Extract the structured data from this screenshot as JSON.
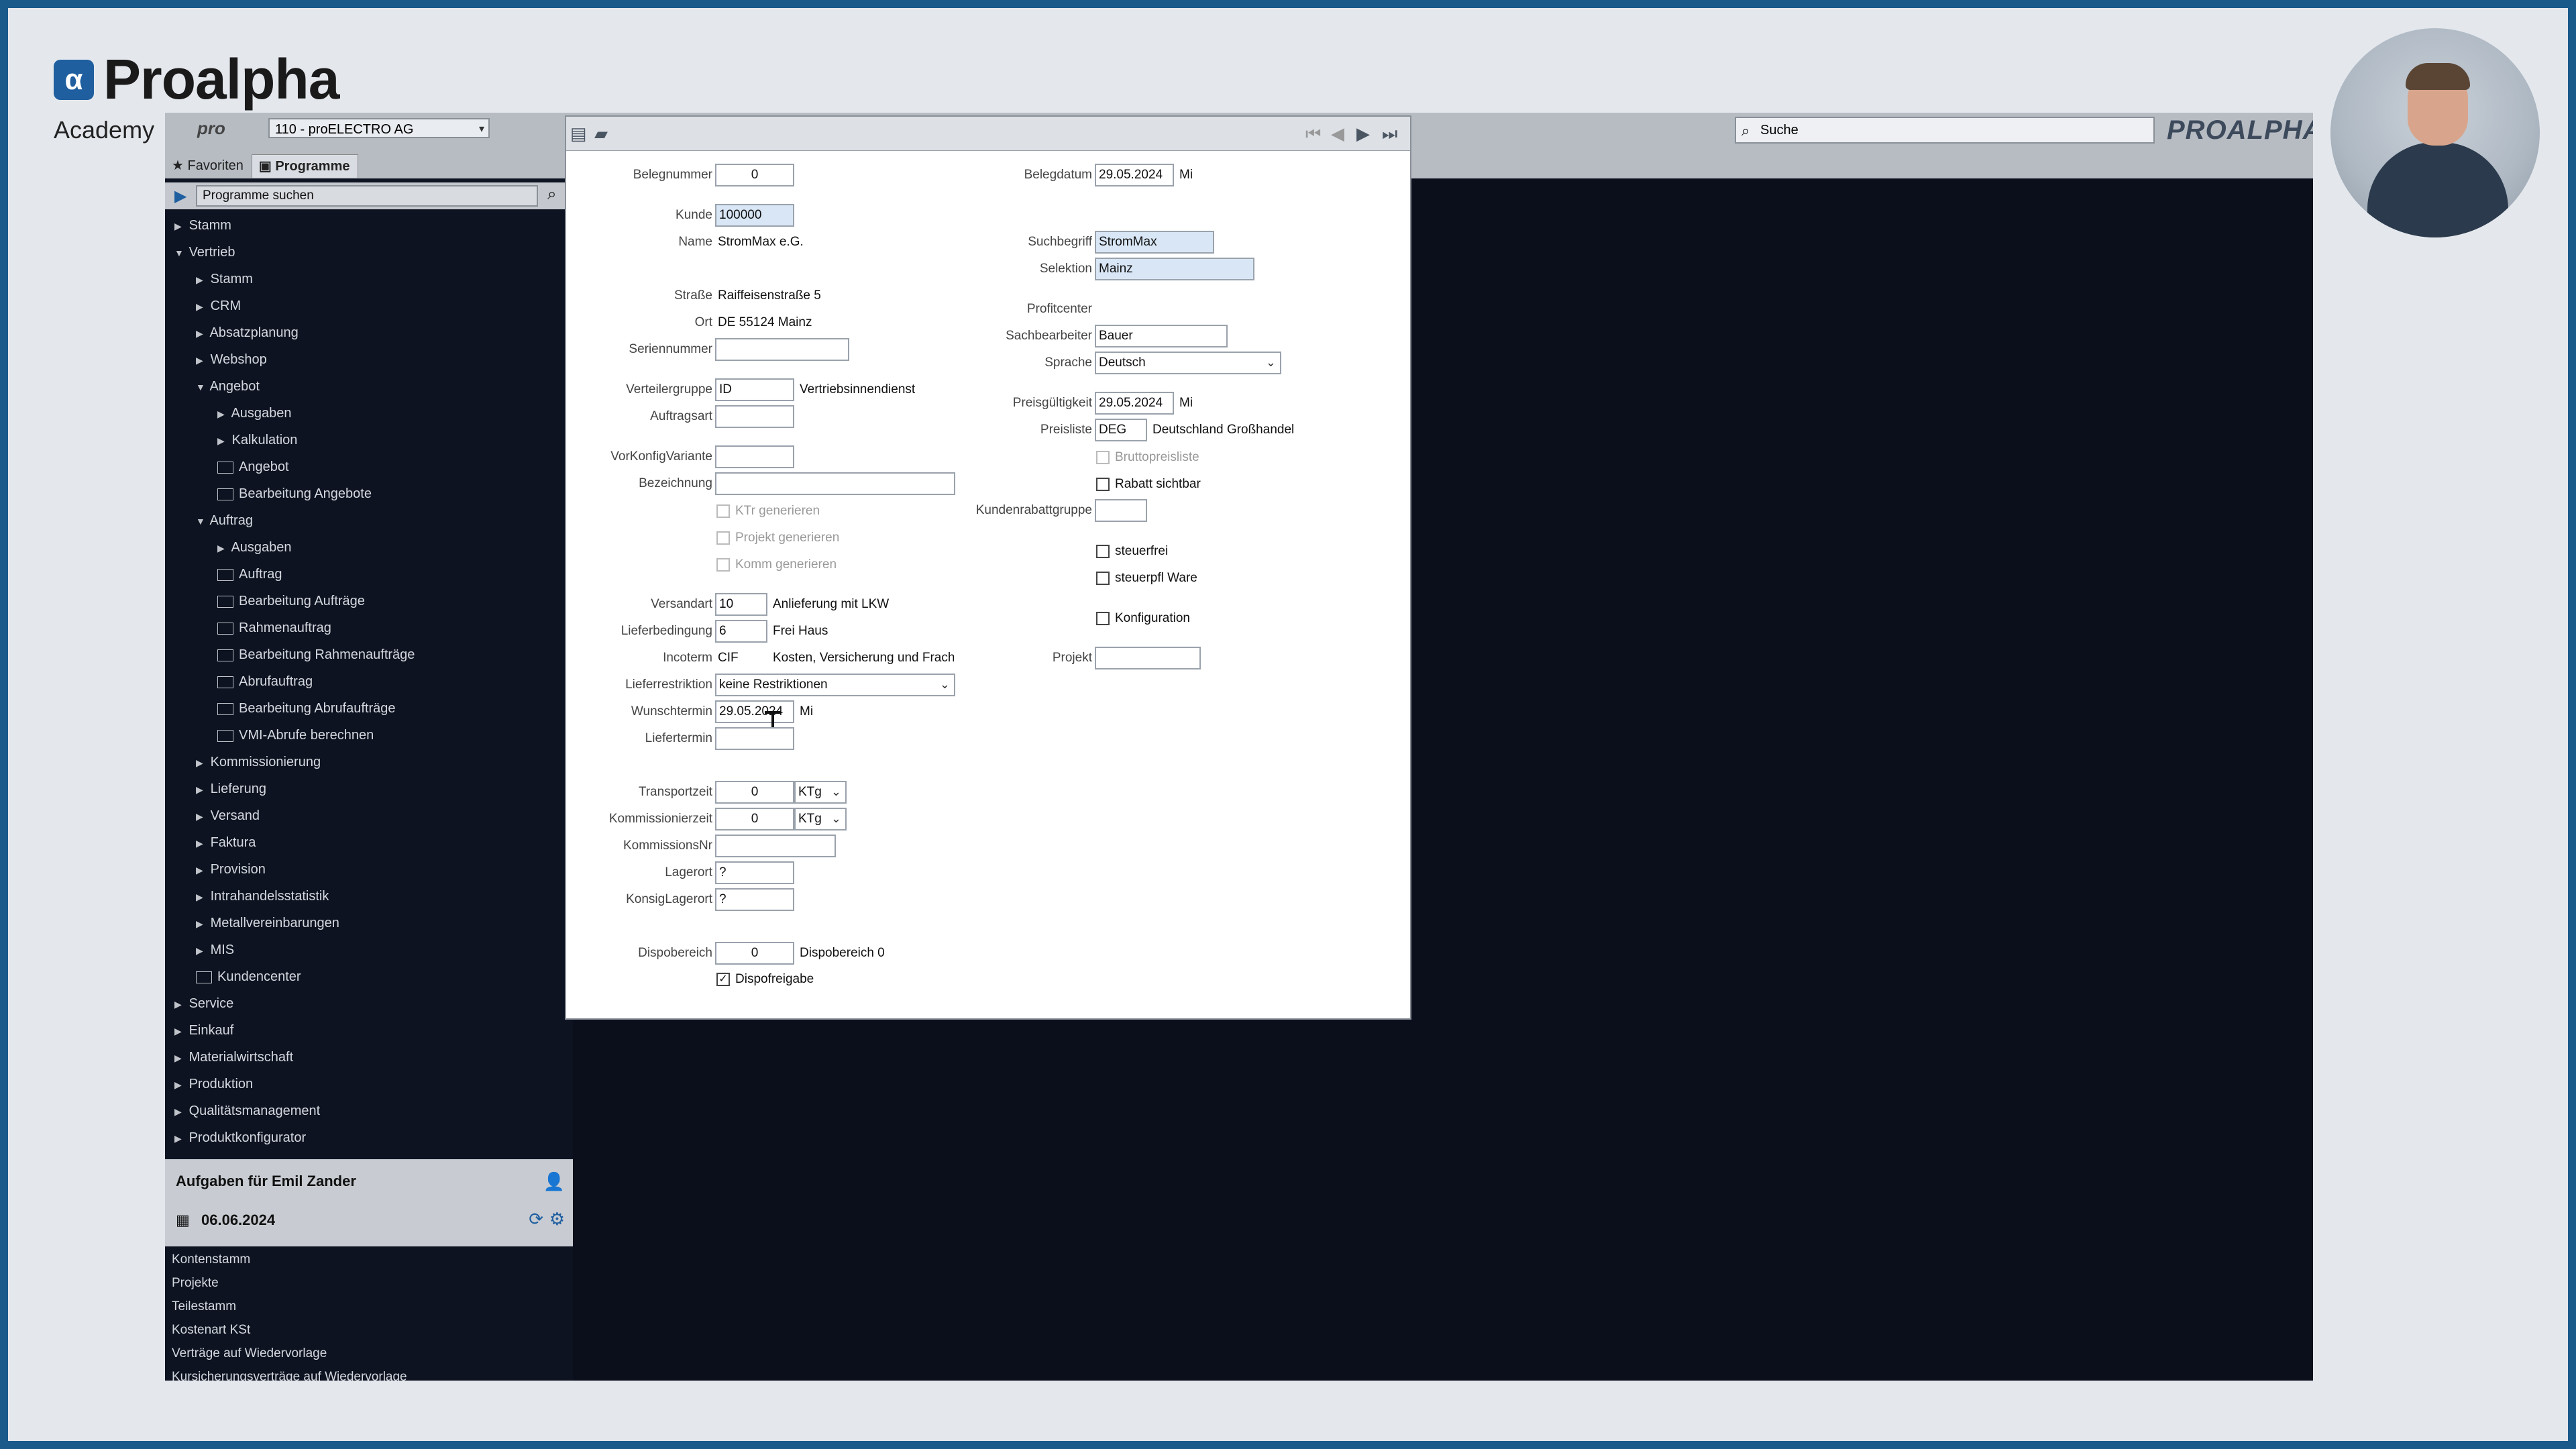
{
  "brand": {
    "name": "Proalpha",
    "sub": "Academy",
    "mark": "α"
  },
  "topbar": {
    "pro_label": "pro",
    "company": "110 - proELECTRO AG",
    "tab_favorites": "Favoriten",
    "tab_programs": "Programme",
    "search_placeholder": "Suche",
    "logo_text": "PROALPHA"
  },
  "sidebar": {
    "program_search": "Programme suchen",
    "tree": [
      {
        "label": "Stamm",
        "level": 0,
        "exp": "closed",
        "icon": false
      },
      {
        "label": "Vertrieb",
        "level": 0,
        "exp": "open",
        "icon": false
      },
      {
        "label": "Stamm",
        "level": 1,
        "exp": "closed",
        "icon": false
      },
      {
        "label": "CRM",
        "level": 1,
        "exp": "closed",
        "icon": false
      },
      {
        "label": "Absatzplanung",
        "level": 1,
        "exp": "closed",
        "icon": false
      },
      {
        "label": "Webshop",
        "level": 1,
        "exp": "closed",
        "icon": false
      },
      {
        "label": "Angebot",
        "level": 1,
        "exp": "open",
        "icon": false
      },
      {
        "label": "Ausgaben",
        "level": 2,
        "exp": "closed",
        "icon": false
      },
      {
        "label": "Kalkulation",
        "level": 2,
        "exp": "closed",
        "icon": false
      },
      {
        "label": "Angebot",
        "level": 2,
        "exp": "",
        "icon": true
      },
      {
        "label": "Bearbeitung Angebote",
        "level": 2,
        "exp": "",
        "icon": true
      },
      {
        "label": "Auftrag",
        "level": 1,
        "exp": "open",
        "icon": false
      },
      {
        "label": "Ausgaben",
        "level": 2,
        "exp": "closed",
        "icon": false
      },
      {
        "label": "Auftrag",
        "level": 2,
        "exp": "",
        "icon": true
      },
      {
        "label": "Bearbeitung Aufträge",
        "level": 2,
        "exp": "",
        "icon": true
      },
      {
        "label": "Rahmenauftrag",
        "level": 2,
        "exp": "",
        "icon": true
      },
      {
        "label": "Bearbeitung Rahmenaufträge",
        "level": 2,
        "exp": "",
        "icon": true
      },
      {
        "label": "Abrufauftrag",
        "level": 2,
        "exp": "",
        "icon": true
      },
      {
        "label": "Bearbeitung Abrufaufträge",
        "level": 2,
        "exp": "",
        "icon": true
      },
      {
        "label": "VMI-Abrufe berechnen",
        "level": 2,
        "exp": "",
        "icon": true
      },
      {
        "label": "Kommissionierung",
        "level": 1,
        "exp": "closed",
        "icon": false
      },
      {
        "label": "Lieferung",
        "level": 1,
        "exp": "closed",
        "icon": false
      },
      {
        "label": "Versand",
        "level": 1,
        "exp": "closed",
        "icon": false
      },
      {
        "label": "Faktura",
        "level": 1,
        "exp": "closed",
        "icon": false
      },
      {
        "label": "Provision",
        "level": 1,
        "exp": "closed",
        "icon": false
      },
      {
        "label": "Intrahandelsstatistik",
        "level": 1,
        "exp": "closed",
        "icon": false
      },
      {
        "label": "Metallvereinbarungen",
        "level": 1,
        "exp": "closed",
        "icon": false
      },
      {
        "label": "MIS",
        "level": 1,
        "exp": "closed",
        "icon": false
      },
      {
        "label": "Kundencenter",
        "level": 1,
        "exp": "",
        "icon": true
      },
      {
        "label": "Service",
        "level": 0,
        "exp": "closed",
        "icon": false
      },
      {
        "label": "Einkauf",
        "level": 0,
        "exp": "closed",
        "icon": false
      },
      {
        "label": "Materialwirtschaft",
        "level": 0,
        "exp": "closed",
        "icon": false
      },
      {
        "label": "Produktion",
        "level": 0,
        "exp": "closed",
        "icon": false
      },
      {
        "label": "Qualitätsmanagement",
        "level": 0,
        "exp": "closed",
        "icon": false
      },
      {
        "label": "Produktkonfigurator",
        "level": 0,
        "exp": "closed",
        "icon": false
      }
    ],
    "tasks_title": "Aufgaben für Emil Zander",
    "tasks_date": "06.06.2024",
    "tasks": [
      "Kontenstamm",
      "Projekte",
      "Teilestamm",
      "Kostenart KSt",
      "Verträge auf Wiedervorlage",
      "Kursicherungsverträge auf Wiedervorlage"
    ]
  },
  "form": {
    "belegnummer_label": "Belegnummer",
    "belegnummer": "0",
    "kunde_label": "Kunde",
    "kunde": "100000",
    "name_label": "Name",
    "name": "StromMax e.G.",
    "strasse_label": "Straße",
    "strasse": "Raiffeisenstraße 5",
    "ort_label": "Ort",
    "ort": "DE 55124 Mainz",
    "seriennummer_label": "Seriennummer",
    "seriennummer": "",
    "verteilergruppe_label": "Verteilergruppe",
    "verteilergruppe": "ID",
    "verteilergruppe_text": "Vertriebsinnendienst",
    "auftragsart_label": "Auftragsart",
    "auftragsart": "",
    "vorkonfig_label": "VorKonfigVariante",
    "vorkonfig": "",
    "bezeichnung_label": "Bezeichnung",
    "bezeichnung": "",
    "ktr_label": "KTr generieren",
    "projekt_gen_label": "Projekt generieren",
    "komm_label": "Komm generieren",
    "versandart_label": "Versandart",
    "versandart": "10",
    "versandart_text": "Anlieferung mit LKW",
    "lieferbedingung_label": "Lieferbedingung",
    "lieferbedingung": "6",
    "lieferbedingung_text": "Frei Haus",
    "incoterm_label": "Incoterm",
    "incoterm": "CIF",
    "incoterm_text": "Kosten, Versicherung und Fracht",
    "lieferrestriktion_label": "Lieferrestriktion",
    "lieferrestriktion": "keine Restriktionen",
    "wunschtermin_label": "Wunschtermin",
    "wunschtermin": "29.05.2024",
    "wunschtermin_day": "Mi",
    "liefertermin_label": "Liefertermin",
    "liefertermin": "",
    "transportzeit_label": "Transportzeit",
    "transportzeit": "0",
    "transportzeit_unit": "KTg",
    "kommzeit_label": "Kommissionierzeit",
    "kommzeit": "0",
    "kommzeit_unit": "KTg",
    "kommnr_label": "KommissionsNr",
    "kommnr": "",
    "lagerort_label": "Lagerort",
    "lagerort": "?",
    "konsig_label": "KonsigLagerort",
    "konsig": "?",
    "dispobereich_label": "Dispobereich",
    "dispobereich": "0",
    "dispobereich_text": "Dispobereich 0",
    "dispofreigabe_label": "Dispofreigabe",
    "belegdatum_label": "Belegdatum",
    "belegdatum": "29.05.2024",
    "belegdatum_day": "Mi",
    "suchbegriff_label": "Suchbegriff",
    "suchbegriff": "StromMax",
    "selektion_label": "Selektion",
    "selektion": "Mainz",
    "profitcenter_label": "Profitcenter",
    "sachbearbeiter_label": "Sachbearbeiter",
    "sachbearbeiter": "Bauer",
    "sprache_label": "Sprache",
    "sprache": "Deutsch",
    "preisgueltigkeit_label": "Preisgültigkeit",
    "preisgueltigkeit": "29.05.2024",
    "preisgueltigkeit_day": "Mi",
    "preisliste_label": "Preisliste",
    "preisliste": "DEG",
    "preisliste_text": "Deutschland Großhandel",
    "bruttopreisliste_label": "Bruttopreisliste",
    "rabatt_label": "Rabatt sichtbar",
    "kundenrabatt_label": "Kundenrabattgruppe",
    "kundenrabatt": "",
    "steuerfrei_label": "steuerfrei",
    "steuerpfl_label": "steuerpfl Ware",
    "konfiguration_label": "Konfiguration",
    "projekt_label": "Projekt",
    "projekt": ""
  }
}
